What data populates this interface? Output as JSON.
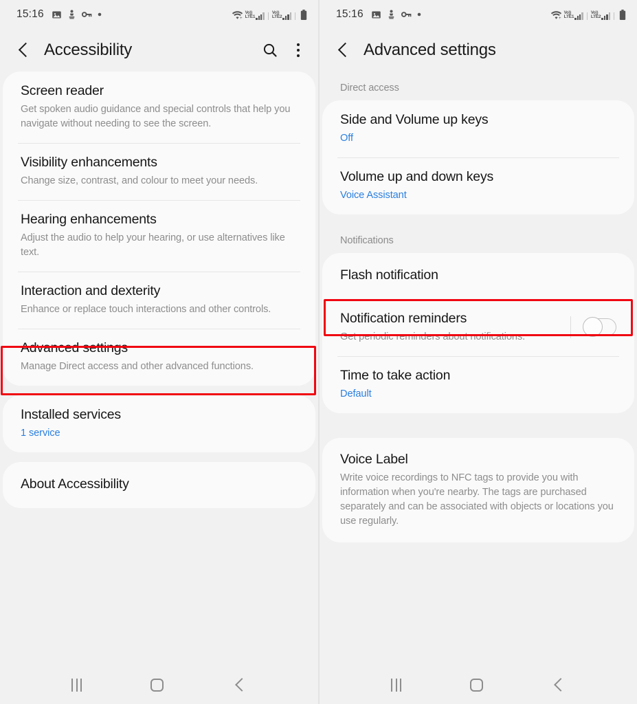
{
  "status_bar": {
    "time": "15:16",
    "left_icons": [
      "image-icon",
      "figure-icon",
      "key-icon",
      "dot-icon"
    ],
    "right_icons": [
      "wifi-icon",
      "volte-lte1-icon",
      "signal-bars-1",
      "volte-lte2-icon",
      "signal-bars-2",
      "battery-icon"
    ],
    "volte_label": "Vo))",
    "sim1_label": "LTE1",
    "sim2_label": "LTE2"
  },
  "left_screen": {
    "app_bar": {
      "title": "Accessibility",
      "back_icon": "back-arrow-icon",
      "search_icon": "search-icon",
      "more_icon": "more-options-icon"
    },
    "cards": [
      {
        "rows": [
          {
            "title": "Screen reader",
            "sub": "Get spoken audio guidance and special controls that help you navigate without needing to see the screen."
          },
          {
            "title": "Visibility enhancements",
            "sub": "Change size, contrast, and colour to meet your needs."
          },
          {
            "title": "Hearing enhancements",
            "sub": "Adjust the audio to help your hearing, or use alternatives like text."
          },
          {
            "title": "Interaction and dexterity",
            "sub": "Enhance or replace touch interactions and other controls."
          },
          {
            "title": "Advanced settings",
            "sub": "Manage Direct access and other advanced functions."
          }
        ]
      },
      {
        "rows": [
          {
            "title": "Installed services",
            "sub": "1 service",
            "sub_accent": true
          }
        ]
      },
      {
        "rows": [
          {
            "title": "About Accessibility",
            "sub": ""
          }
        ]
      }
    ],
    "highlight": {
      "target": "Advanced settings",
      "color": "#f00611"
    }
  },
  "right_screen": {
    "app_bar": {
      "title": "Advanced settings",
      "back_icon": "back-arrow-icon"
    },
    "sections": [
      {
        "label": "Direct access",
        "rows": [
          {
            "title": "Side and Volume up keys",
            "sub": "Off",
            "sub_accent": true
          },
          {
            "title": "Volume up and down keys",
            "sub": "Voice Assistant",
            "sub_accent": true
          }
        ]
      },
      {
        "label": "Notifications",
        "rows": [
          {
            "title": "Flash notification",
            "sub": ""
          },
          {
            "title": "Notification reminders",
            "sub": "Get periodic reminders about notifications.",
            "toggle": "off"
          },
          {
            "title": "Time to take action",
            "sub": "Default",
            "sub_accent": true
          }
        ]
      },
      {
        "label": "",
        "rows": [
          {
            "title": "Voice Label",
            "sub": "Write voice recordings to NFC tags to provide you with information when you're nearby. The tags are purchased separately and can be associated with objects or locations you use regularly."
          }
        ]
      }
    ],
    "highlight": {
      "target": "Flash notification",
      "color": "#f00611"
    }
  },
  "nav_bar": {
    "recents_icon": "recents-icon",
    "home_icon": "home-icon",
    "back_icon": "back-icon"
  },
  "colors": {
    "accent": "#2a7fe0",
    "highlight": "#f00611",
    "background": "#f1f1f1",
    "card": "#fafafa"
  }
}
